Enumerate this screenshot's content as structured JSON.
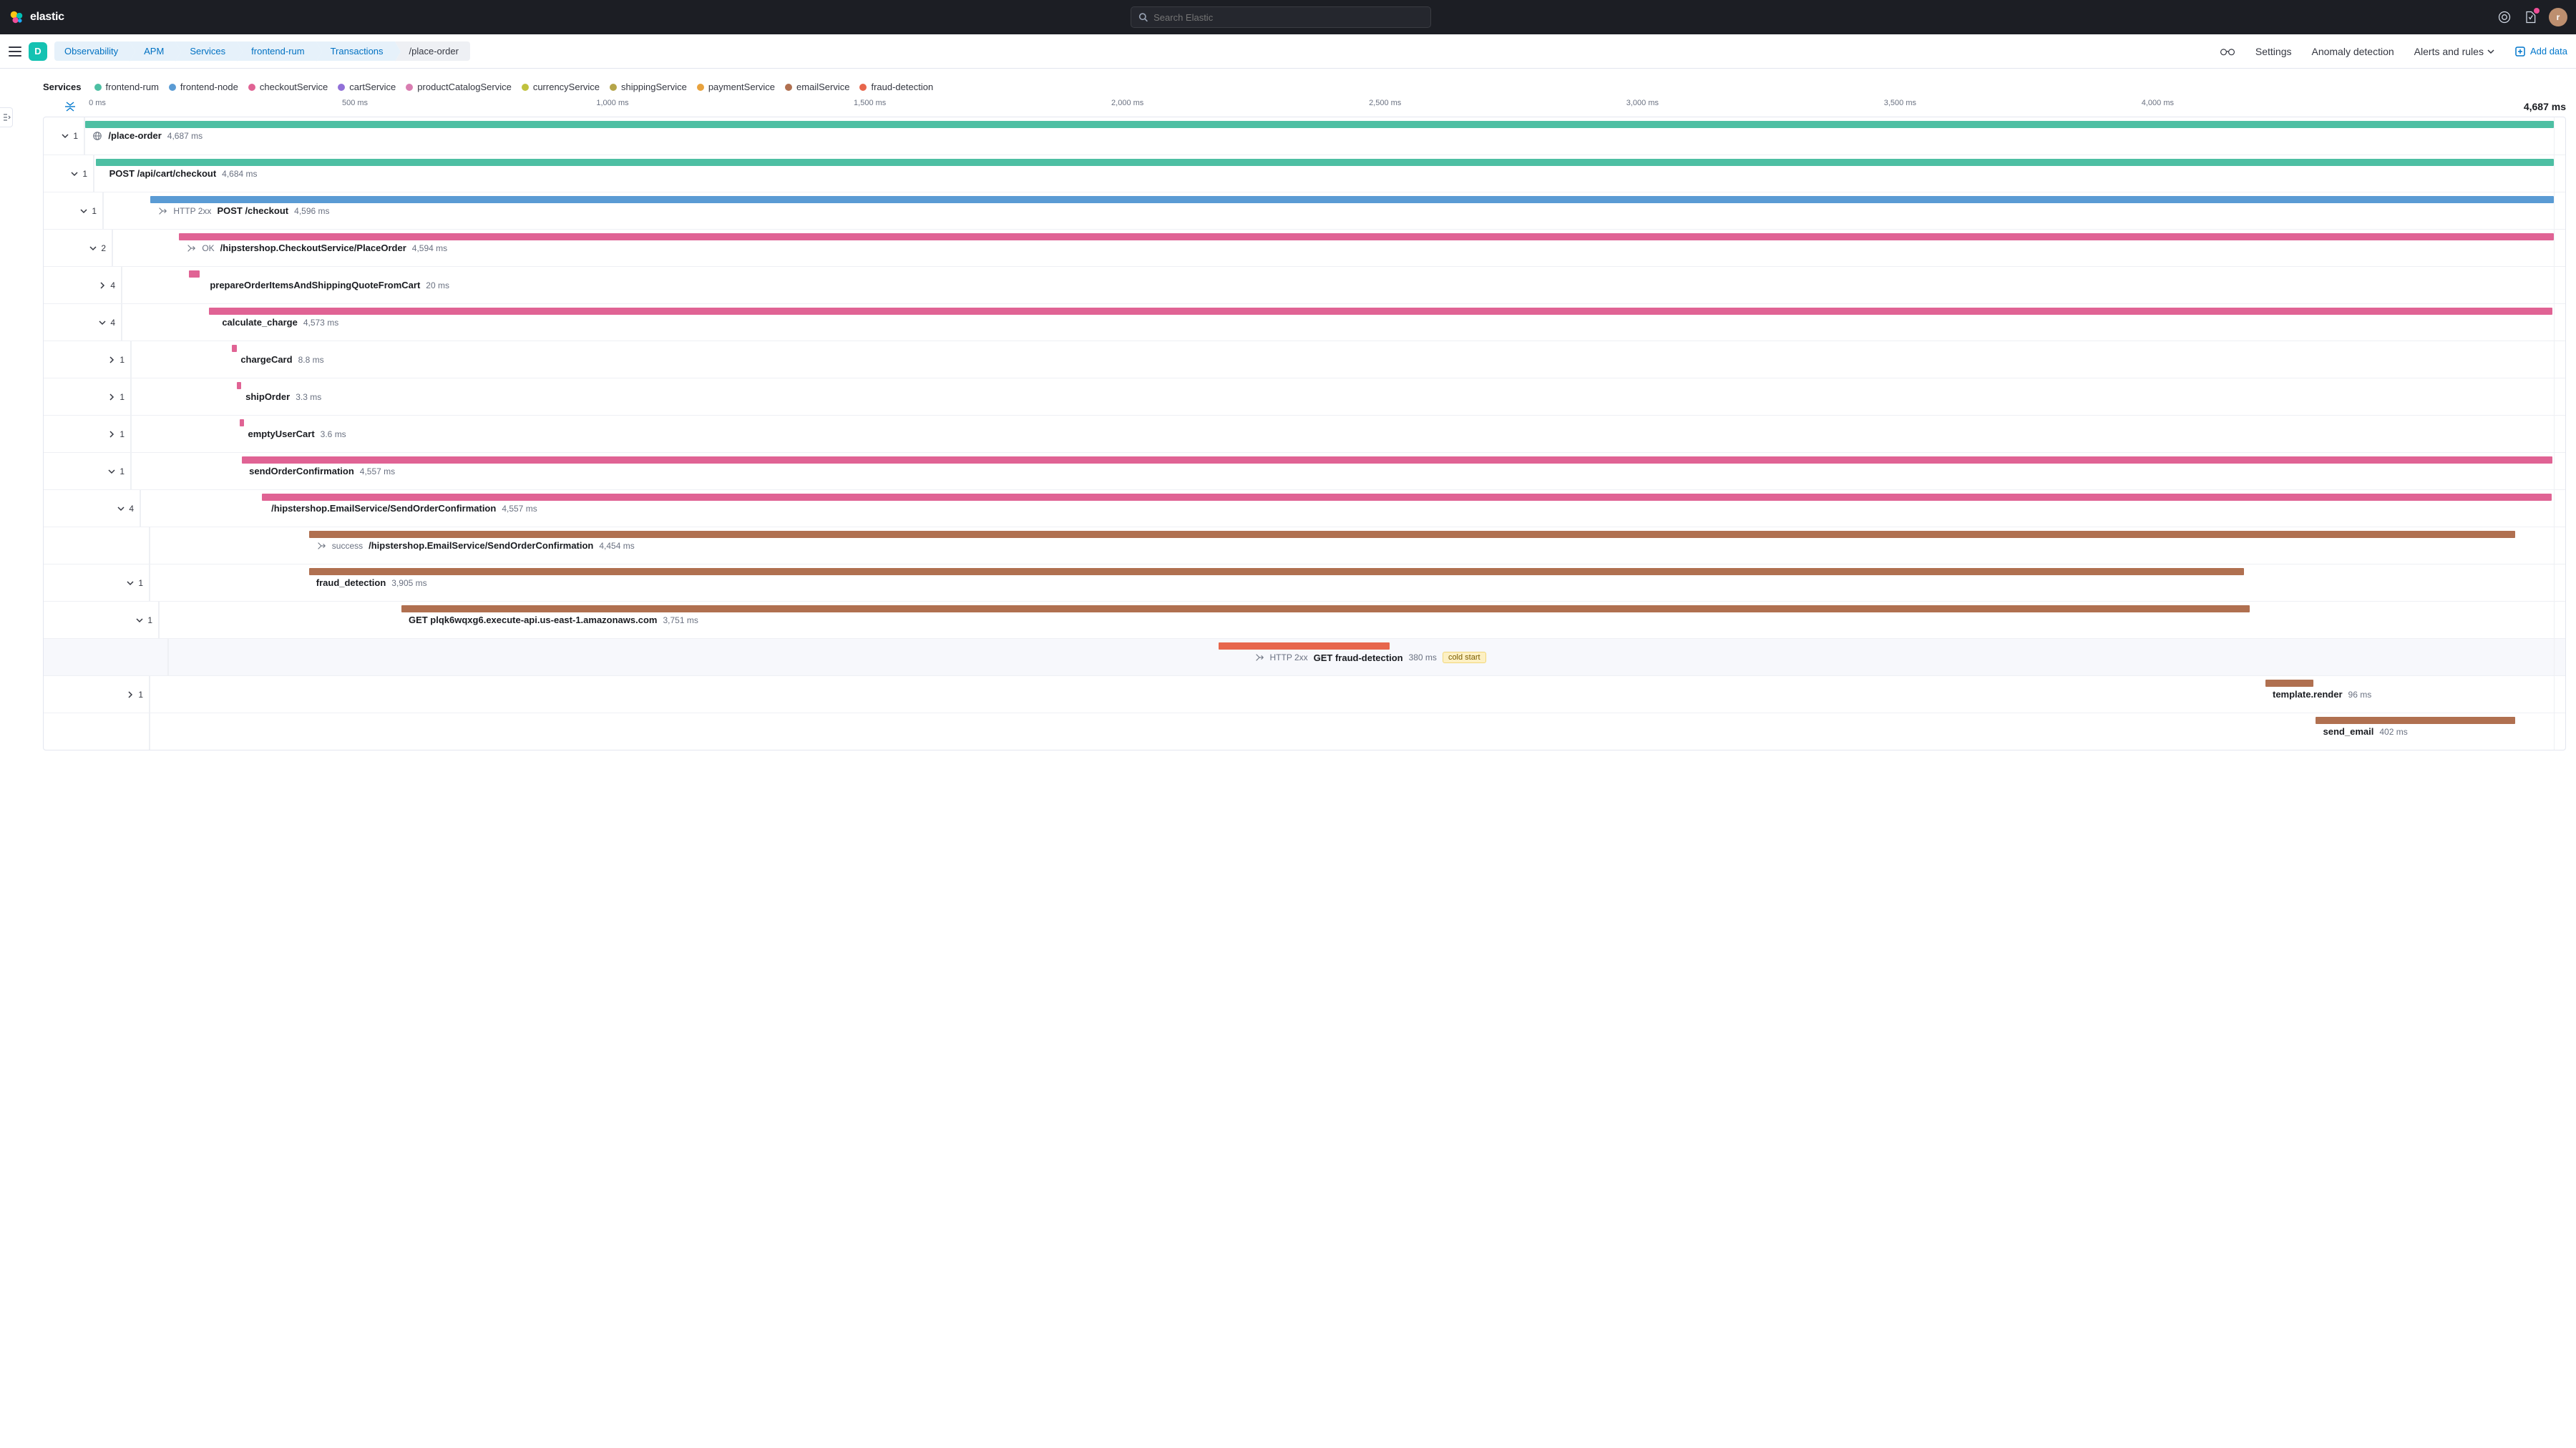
{
  "brand": "elastic",
  "search": {
    "placeholder": "Search Elastic"
  },
  "space_letter": "D",
  "avatar_letter": "r",
  "breadcrumbs": [
    "Observability",
    "APM",
    "Services",
    "frontend-rum",
    "Transactions",
    "/place-order"
  ],
  "subnav": {
    "settings": "Settings",
    "anomaly": "Anomaly detection",
    "alerts": "Alerts and rules",
    "add_data": "Add data"
  },
  "legend_label": "Services",
  "services": [
    {
      "name": "frontend-rum",
      "color": "#4dbfa3"
    },
    {
      "name": "frontend-node",
      "color": "#5a9bd4"
    },
    {
      "name": "checkoutService",
      "color": "#e06394"
    },
    {
      "name": "cartService",
      "color": "#9170d8"
    },
    {
      "name": "productCatalogService",
      "color": "#d97db1"
    },
    {
      "name": "currencyService",
      "color": "#c0c23e"
    },
    {
      "name": "shippingService",
      "color": "#b5a54a"
    },
    {
      "name": "paymentService",
      "color": "#e8a23d"
    },
    {
      "name": "emailService",
      "color": "#b07050"
    },
    {
      "name": "fraud-detection",
      "color": "#e7664c"
    }
  ],
  "total_duration": "4,687 ms",
  "ticks": [
    {
      "label": "0 ms",
      "pct": 0
    },
    {
      "label": "500 ms",
      "pct": 10.67
    },
    {
      "label": "1,000 ms",
      "pct": 21.34
    },
    {
      "label": "1,500 ms",
      "pct": 32.0
    },
    {
      "label": "2,000 ms",
      "pct": 42.67
    },
    {
      "label": "2,500 ms",
      "pct": 53.34
    },
    {
      "label": "3,000 ms",
      "pct": 64.0
    },
    {
      "label": "3,500 ms",
      "pct": 74.67
    },
    {
      "label": "4,000 ms",
      "pct": 85.34
    }
  ],
  "spans": [
    {
      "depth": 0,
      "count": "1",
      "open": true,
      "icon": "globe",
      "name": "/place-order",
      "duration": "4,687 ms",
      "color": "#4dbfa3",
      "start_pct": 0,
      "width_pct": 100,
      "label_left_pct": 0.3
    },
    {
      "depth": 1,
      "count": "1",
      "open": true,
      "name": "POST /api/cart/checkout",
      "duration": "4,684 ms",
      "color": "#4dbfa3",
      "start_pct": 0.06,
      "width_pct": 99.94,
      "label_left_pct": 0.6
    },
    {
      "depth": 2,
      "count": "1",
      "open": true,
      "prefix": "HTTP 2xx",
      "icon": "merge",
      "name": "POST /checkout",
      "duration": "4,596 ms",
      "color": "#5a9bd4",
      "start_pct": 1.9,
      "width_pct": 98.1,
      "label_left_pct": 2.2
    },
    {
      "depth": 3,
      "count": "2",
      "open": true,
      "prefix": "OK",
      "icon": "merge",
      "name": "/hipstershop.CheckoutService/PlaceOrder",
      "duration": "4,594 ms",
      "color": "#e06394",
      "start_pct": 2.7,
      "width_pct": 97.3,
      "label_left_pct": 3.0
    },
    {
      "depth": 4,
      "count": "4",
      "open": false,
      "name": "prepareOrderItemsAndShippingQuoteFromCart",
      "duration": "20 ms",
      "color": "#e06394",
      "start_pct": 2.75,
      "width_pct": 0.43,
      "label_left_pct": 3.6
    },
    {
      "depth": 4,
      "count": "4",
      "open": true,
      "name": "calculate_charge",
      "duration": "4,573 ms",
      "color": "#e06394",
      "start_pct": 3.55,
      "width_pct": 96.4,
      "label_left_pct": 4.1
    },
    {
      "depth": 5,
      "count": "1",
      "open": false,
      "name": "chargeCard",
      "duration": "8.8 ms",
      "color": "#e06394",
      "start_pct": 4.15,
      "width_pct": 0.19,
      "label_left_pct": 4.5
    },
    {
      "depth": 5,
      "count": "1",
      "open": false,
      "name": "shipOrder",
      "duration": "3.3 ms",
      "color": "#e06394",
      "start_pct": 4.35,
      "width_pct": 0.1,
      "label_left_pct": 4.7
    },
    {
      "depth": 5,
      "count": "1",
      "open": false,
      "name": "emptyUserCart",
      "duration": "3.6 ms",
      "color": "#e06394",
      "start_pct": 4.45,
      "width_pct": 0.1,
      "label_left_pct": 4.8
    },
    {
      "depth": 5,
      "count": "1",
      "open": true,
      "name": "sendOrderConfirmation",
      "duration": "4,557 ms",
      "color": "#e06394",
      "start_pct": 4.55,
      "width_pct": 95.4,
      "label_left_pct": 4.85
    },
    {
      "depth": 6,
      "count": "4",
      "open": true,
      "name": "/hipstershop.EmailService/SendOrderConfirmation",
      "duration": "4,557 ms",
      "color": "#e06394",
      "start_pct": 5.0,
      "width_pct": 94.9,
      "label_left_pct": 5.4
    },
    {
      "depth": 7,
      "count": "",
      "open": null,
      "prefix": "success",
      "icon": "merge",
      "name": "/hipstershop.EmailService/SendOrderConfirmation",
      "duration": "4,454 ms",
      "color": "#b07050",
      "start_pct": 6.6,
      "width_pct": 91.8,
      "label_left_pct": 6.9
    },
    {
      "depth": 7,
      "count": "1",
      "open": true,
      "name": "fraud_detection",
      "duration": "3,905 ms",
      "color": "#b07050",
      "start_pct": 6.6,
      "width_pct": 80.5,
      "label_left_pct": 6.9
    },
    {
      "depth": 8,
      "count": "1",
      "open": true,
      "name": "GET plqk6wqxg6.execute-api.us-east-1.amazonaws.com",
      "duration": "3,751 ms",
      "color": "#b07050",
      "start_pct": 10.1,
      "width_pct": 77.2,
      "label_left_pct": 10.4
    },
    {
      "depth": 9,
      "count": "",
      "open": null,
      "prefix": "HTTP 2xx",
      "icon": "merge",
      "name": "GET fraud-detection",
      "duration": "380 ms",
      "badge": "cold start",
      "color": "#e7664c",
      "start_pct": 44.0,
      "width_pct": 7.2,
      "label_left_pct": 45.5,
      "highlight": true
    },
    {
      "depth": 7,
      "count": "1",
      "open": false,
      "name": "template.render",
      "duration": "96 ms",
      "color": "#b07050",
      "start_pct": 88.0,
      "width_pct": 2.0,
      "label_left_pct": 88.3,
      "label_align": "left-of-end"
    },
    {
      "depth": 7,
      "count": "",
      "open": null,
      "name": "send_email",
      "duration": "402 ms",
      "color": "#b07050",
      "start_pct": 90.1,
      "width_pct": 8.3,
      "label_left_pct": 90.4,
      "label_align": "left-of-end"
    }
  ]
}
